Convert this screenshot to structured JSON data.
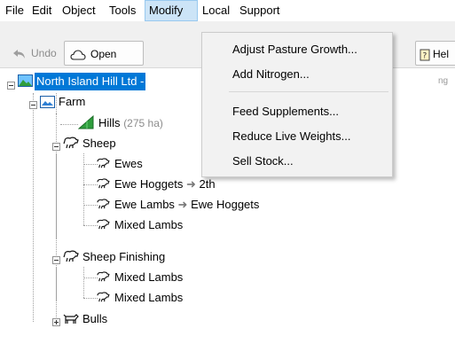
{
  "menubar": {
    "items": [
      {
        "label": "File"
      },
      {
        "label": "Edit"
      },
      {
        "label": "Object"
      },
      {
        "label": "Tools"
      },
      {
        "label": "Modify"
      },
      {
        "label": "Local"
      },
      {
        "label": "Support"
      }
    ]
  },
  "toolbar": {
    "undo_label": "Undo",
    "open_label": "Open",
    "help_label": "Hel"
  },
  "tree": {
    "root_label": "North Island Hill Ltd -",
    "root_trail": "ng",
    "farm_label": "Farm",
    "hills_label": "Hills",
    "hills_area": "(275 ha)",
    "sheep_label": "Sheep",
    "ewes_label": "Ewes",
    "ewe_hoggets_label": "Ewe Hoggets",
    "ewe_hoggets_target": "2th",
    "ewe_lambs_label": "Ewe Lambs",
    "ewe_lambs_target": "Ewe Hoggets",
    "mixed_lambs_label": "Mixed Lambs",
    "sheep_finishing_label": "Sheep Finishing",
    "finishing_mixed_lambs_1": "Mixed Lambs",
    "finishing_mixed_lambs_2": "Mixed Lambs",
    "bulls_label": "Bulls",
    "arrow": "➜"
  },
  "modify_menu": {
    "items": [
      {
        "label": "Adjust Pasture Growth..."
      },
      {
        "label": "Add Nitrogen..."
      },
      {
        "label": "Feed Supplements..."
      },
      {
        "label": "Reduce Live Weights..."
      },
      {
        "label": "Sell Stock..."
      }
    ]
  },
  "colors": {
    "selection": "#0078d7",
    "menu_highlight": "#cce4f7",
    "menu_background": "#f2f2f2"
  }
}
